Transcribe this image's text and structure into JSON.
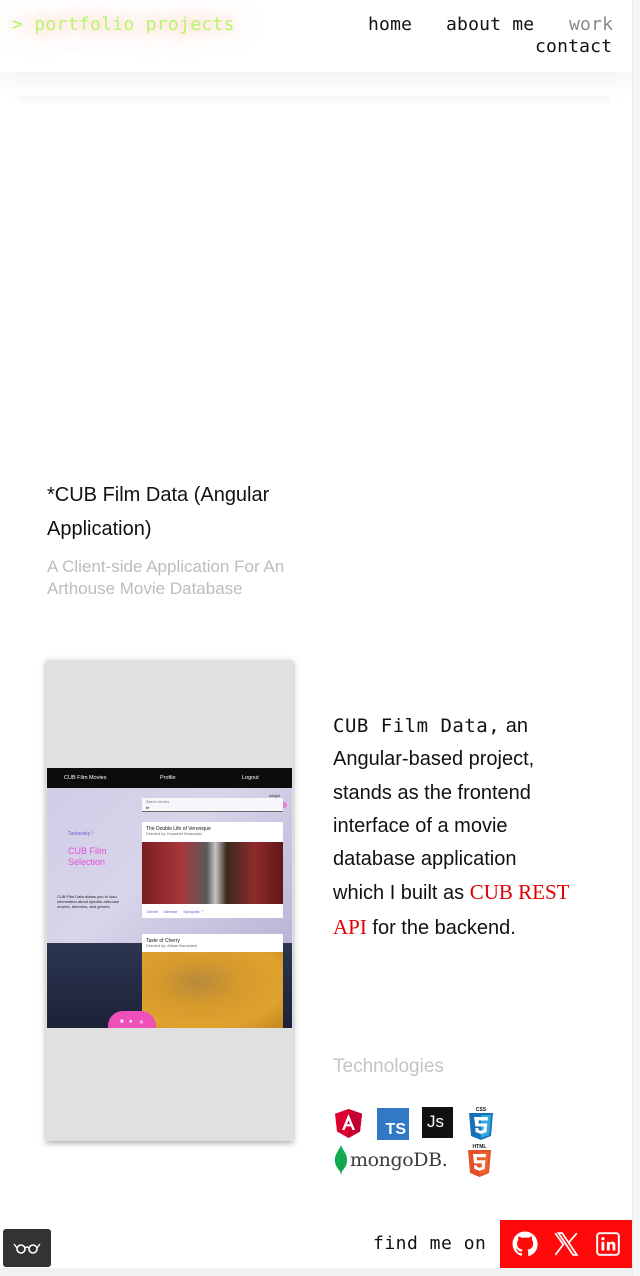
{
  "header": {
    "logo": "> portfolio projects",
    "nav": {
      "home": "home",
      "about": "about me",
      "work": "work",
      "contact": "contact"
    },
    "active": "work"
  },
  "project": {
    "title": "*CUB Film Data (Angular Application)",
    "subtitle": "A Client-side Application For An Arthouse Movie Database",
    "description": {
      "code_name": "CUB Film Data,",
      "text_1": " an Angular-based project, stands as the frontend interface of a movie database application which I built as ",
      "link_text": "CUB REST API",
      "text_2": " for the backend."
    },
    "technologies_label": "Technologies",
    "technologies": [
      "angular-icon",
      "typescript-icon",
      "javascript-icon",
      "css3-icon",
      "mongodb-logo",
      "html5-icon"
    ],
    "tech_text": {
      "ts": "TS",
      "js": "Js",
      "css": "CSS",
      "html": "HTML",
      "mongo": "mongoDB."
    }
  },
  "screenshot": {
    "nav": {
      "movies": "CUB Film Movies",
      "profile": "Profile",
      "logout": "Logout"
    },
    "toggle_label": "twilight",
    "greeting": "Tarkovsky !",
    "hero_title": "CUB Film Selection",
    "hero_desc": "CUB Film Data allows you to load information about specific arthouse movies, directors, and genres.",
    "search_label": "Search Movies",
    "search_value": "te",
    "movies": [
      {
        "title": "The Double Life of Veronique",
        "director": "Directed by: Krzysztof Kieslowski"
      },
      {
        "title": "Taste of Cherry",
        "director": "Directed by: Abbas Kiarostami"
      }
    ],
    "links": {
      "genre": "Genre",
      "director": "Director",
      "synopsis": "Synopsis"
    }
  },
  "footer": {
    "find_label": "find me on",
    "social": [
      "github-icon",
      "x-icon",
      "linkedin-icon"
    ]
  },
  "colors": {
    "accent_red": "#ff0a0a",
    "logo_green": "#b7f56b",
    "api_red": "#e00000",
    "muted": "#bdbdbd"
  }
}
